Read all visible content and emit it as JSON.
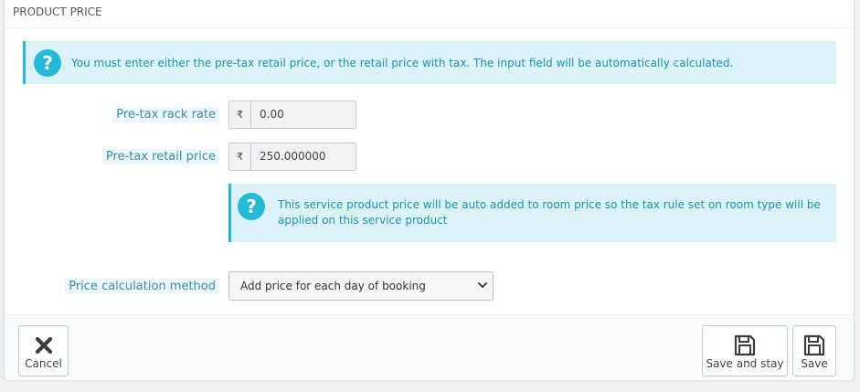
{
  "panel": {
    "title": "PRODUCT PRICE"
  },
  "alerts": {
    "info_main": "You must enter either the pre-tax retail price, or the retail price with tax. The input field will be automatically calculated.",
    "info_service": "This service product price will be auto added to room price so the tax rule set on room type will be applied on this service product",
    "icon": "question-icon",
    "icon_glyph": "?"
  },
  "form": {
    "rack_rate": {
      "label": "Pre-tax rack rate",
      "currency": "₹",
      "value": "0.00"
    },
    "retail_price": {
      "label": "Pre-tax retail price",
      "currency": "₹",
      "value": "250.000000"
    },
    "calc_method": {
      "label": "Price calculation method",
      "selected": "Add price for each day of booking"
    }
  },
  "footer": {
    "cancel_label": "Cancel",
    "save_stay_label": "Save and stay",
    "save_label": "Save"
  },
  "colors": {
    "accent": "#25b9d7",
    "alert_bg": "#dbf2f7",
    "label_text": "#3a8ea6"
  }
}
